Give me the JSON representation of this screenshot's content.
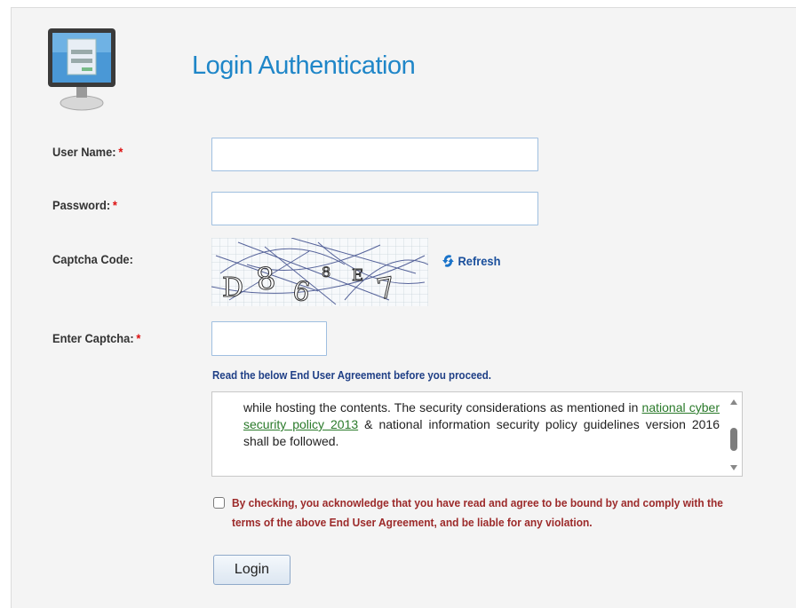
{
  "header": {
    "title": "Login Authentication",
    "icon": "computer-monitor-icon"
  },
  "form": {
    "username_label": "User Name:",
    "password_label": "Password:",
    "captcha_label": "Captcha Code:",
    "enter_captcha_label": "Enter Captcha:",
    "required_mark": "*",
    "username_value": "",
    "password_value": "",
    "captcha_input_value": ""
  },
  "captcha": {
    "chars": [
      "D",
      "8",
      "6",
      "8",
      "E",
      "7"
    ],
    "refresh_label": "Refresh",
    "refresh_icon": "refresh-icon"
  },
  "agreement": {
    "heading": "Read the below End User Agreement before you proceed.",
    "text_before": "while hosting the contents. The security considerations as mentioned in",
    "link_text": "national cyber security policy 2013",
    "text_after": "& national information security policy guidelines version 2016 shall be followed.",
    "checkbox_label": "By checking, you acknowledge that you have read and agree to be bound by and comply with the terms of the above End User Agreement, and be liable for any violation.",
    "checked": false
  },
  "actions": {
    "login_label": "Login"
  },
  "colors": {
    "title": "#1f86c8",
    "required": "#dd1111",
    "agree_heading": "#1f3f86",
    "checkbox_text": "#9c2a2a",
    "link": "#2a7a2a"
  }
}
